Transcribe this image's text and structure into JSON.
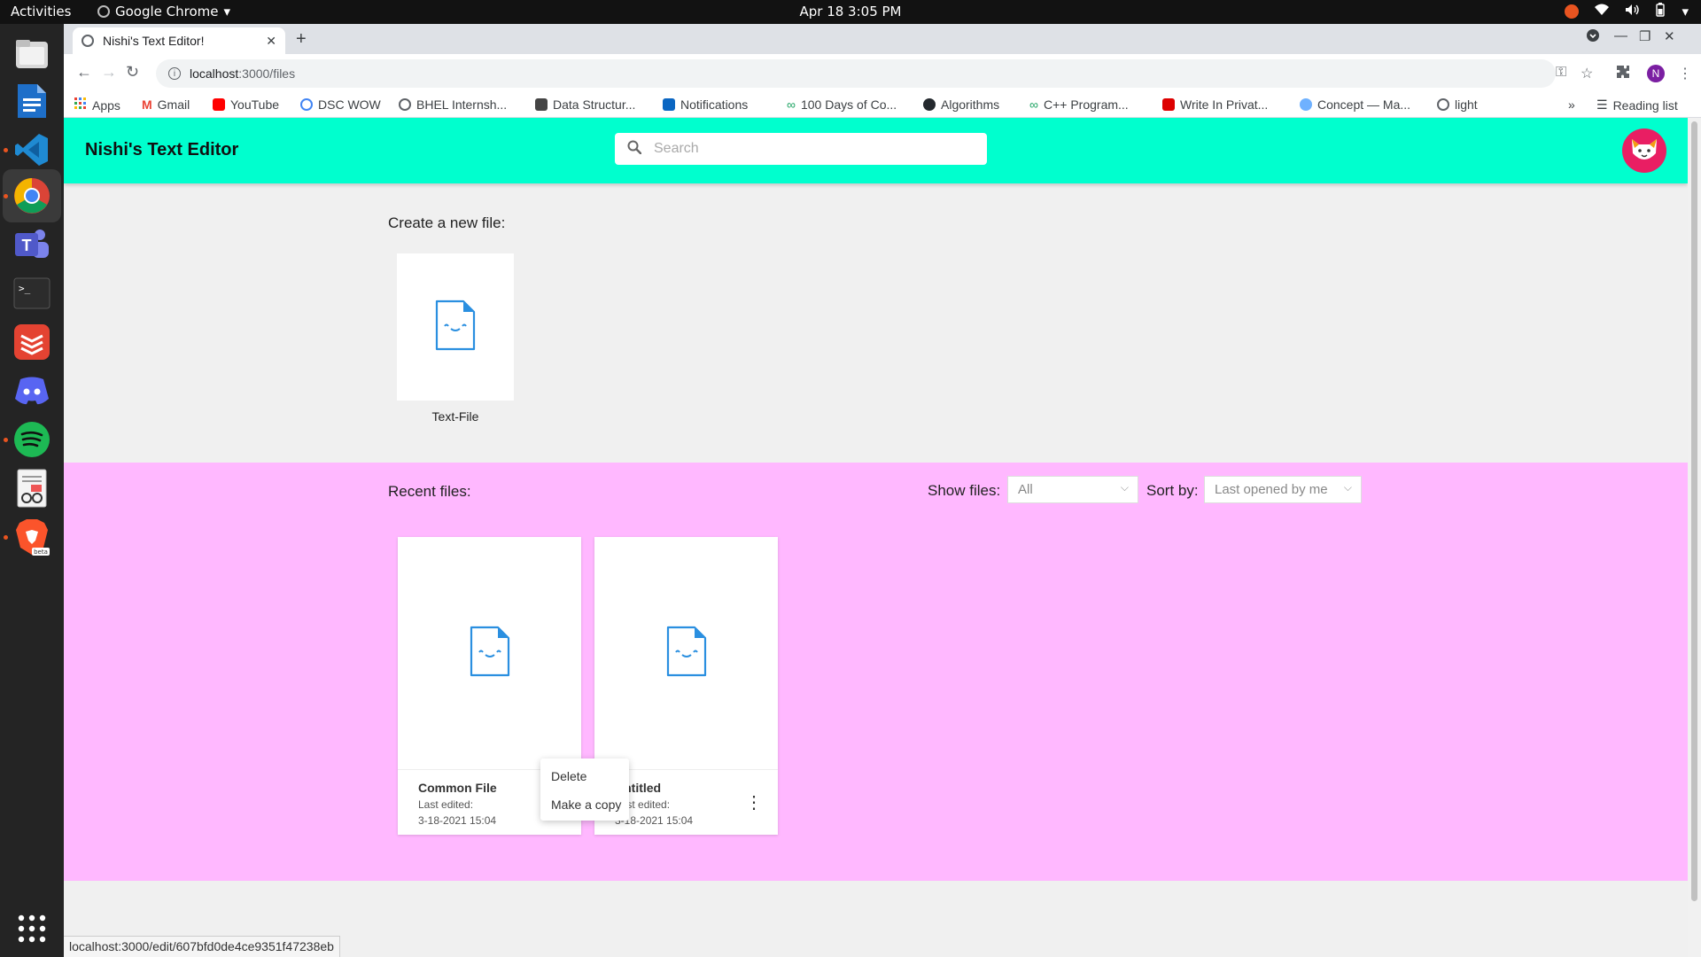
{
  "system": {
    "activities": "Activities",
    "app_name": "Google Chrome",
    "clock": "Apr 18  3:05 PM"
  },
  "dock": {
    "apps": [
      "files",
      "libreoffice-writer",
      "vscode",
      "chrome",
      "teams",
      "terminal",
      "todoist",
      "discord",
      "spotify",
      "document-viewer",
      "brave"
    ]
  },
  "browser": {
    "tab_title": "Nishi's Text Editor!",
    "url_host": "localhost",
    "url_path": ":3000/files",
    "profile_initial": "N",
    "bookmarks": [
      "Apps",
      "Gmail",
      "YouTube",
      "DSC WOW",
      "BHEL Internsh...",
      "Data Structur...",
      "Notifications",
      "100 Days of Co...",
      "Algorithms",
      "C++ Program...",
      "Write In Privat...",
      "Concept — Ma...",
      "light"
    ],
    "more_bookmarks": "»",
    "reading_list": "Reading list",
    "status_url": "localhost:3000/edit/607bfd0de4ce9351f47238eb"
  },
  "app": {
    "brand": "Nishi's Text Editor",
    "search_placeholder": "Search",
    "create_label": "Create a new file:",
    "create_template": "Text-File",
    "recent_label": "Recent files:",
    "show_files_label": "Show files:",
    "show_files_value": "All",
    "sort_label": "Sort by:",
    "sort_value": "Last opened by me",
    "files": [
      {
        "name": "Common File",
        "meta_label": "Last edited:",
        "date": "3-18-2021 15:04"
      },
      {
        "name": "Untitled",
        "meta_label": "Last edited:",
        "date": "3-18-2021 15:04"
      }
    ],
    "context_menu": [
      "Delete",
      "Make a copy"
    ]
  },
  "colors": {
    "header": "#00ffce",
    "recent_bg": "#ffb8ff",
    "file_icon": "#2a8fe0",
    "avatar": "#e91e63"
  }
}
